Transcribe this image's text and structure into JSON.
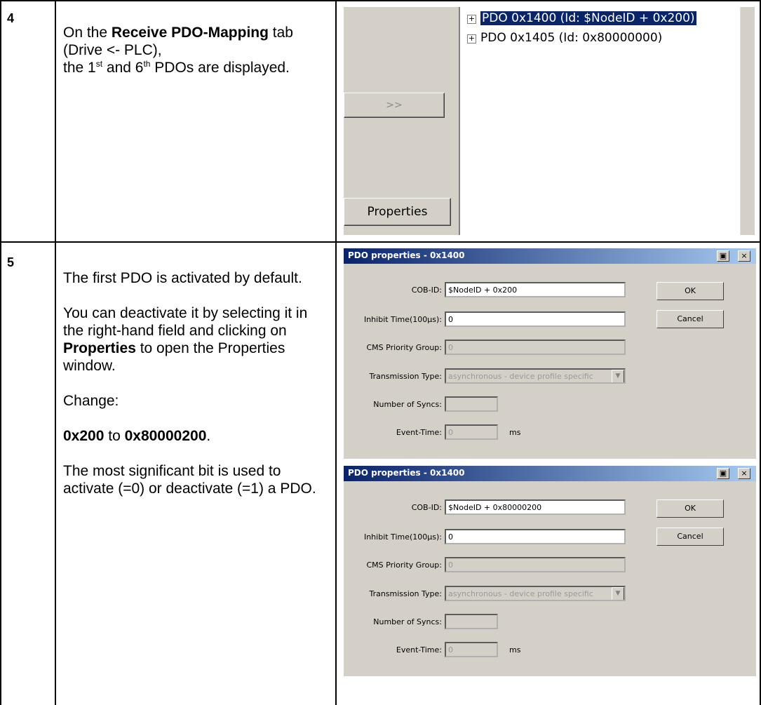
{
  "steps": [
    {
      "number": "4",
      "text": [
        [
          {
            "t": "On the "
          },
          {
            "t": "Receive PDO-Mapping",
            "b": true
          },
          {
            "t": " tab (Drive <- PLC),"
          }
        ],
        [
          {
            "t": "the 1"
          },
          {
            "t": "st",
            "sup": true
          },
          {
            "t": " and 6"
          },
          {
            "t": "th",
            "sup": true
          },
          {
            "t": " PDOs are displayed."
          }
        ]
      ]
    },
    {
      "number": "5",
      "paragraphs": [
        [
          {
            "t": "The first PDO is activated by default."
          }
        ],
        [
          {
            "t": "You can deactivate it by selecting it in the right-hand field and clicking on "
          },
          {
            "t": "Properties",
            "b": true
          },
          {
            "t": " to open the Properties window."
          }
        ],
        [
          {
            "t": "Change:"
          }
        ],
        [
          {
            "t": "0x200",
            "b": true
          },
          {
            "t": " to "
          },
          {
            "t": "0x80000200",
            "b": true
          },
          {
            "t": "."
          }
        ],
        [
          {
            "t": "The most significant bit is used to activate (=0) or deactivate (=1) a PDO."
          }
        ]
      ]
    }
  ],
  "screenshot1": {
    "arrow_button": ">>",
    "properties_button": "Properties",
    "tree_items": [
      {
        "label": "PDO 0x1400 (Id: $NodeID + 0x200)",
        "selected": true,
        "icon": "plus-box-icon"
      },
      {
        "label": "PDO 0x1405 (Id: 0x80000000)",
        "selected": false,
        "icon": "plus-box-icon"
      }
    ]
  },
  "dialogs": [
    {
      "title": "PDO properties - 0x1400",
      "cob_id_label": "COB-ID:",
      "cob_id_value": "$NodeID + 0x200",
      "inhibit_label": "Inhibit Time(100µs):",
      "inhibit_value": "0",
      "cms_label": "CMS Priority Group:",
      "cms_value": "0",
      "trans_label": "Transmission Type:",
      "trans_value": "asynchronous - device profile specific",
      "syncs_label": "Number of Syncs:",
      "syncs_value": "",
      "event_label": "Event-Time:",
      "event_value": "0",
      "event_unit": "ms",
      "ok_label": "OK",
      "cancel_label": "Cancel",
      "help_icon": "help-icon",
      "close_glyph": "×"
    },
    {
      "title": "PDO properties - 0x1400",
      "cob_id_label": "COB-ID:",
      "cob_id_value": "$NodeID + 0x80000200",
      "inhibit_label": "Inhibit Time(100µs):",
      "inhibit_value": "0",
      "cms_label": "CMS Priority Group:",
      "cms_value": "0",
      "trans_label": "Transmission Type:",
      "trans_value": "asynchronous - device profile specific",
      "syncs_label": "Number of Syncs:",
      "syncs_value": "",
      "event_label": "Event-Time:",
      "event_value": "0",
      "event_unit": "ms",
      "ok_label": "OK",
      "cancel_label": "Cancel",
      "help_icon": "help-icon",
      "close_glyph": "×"
    }
  ]
}
